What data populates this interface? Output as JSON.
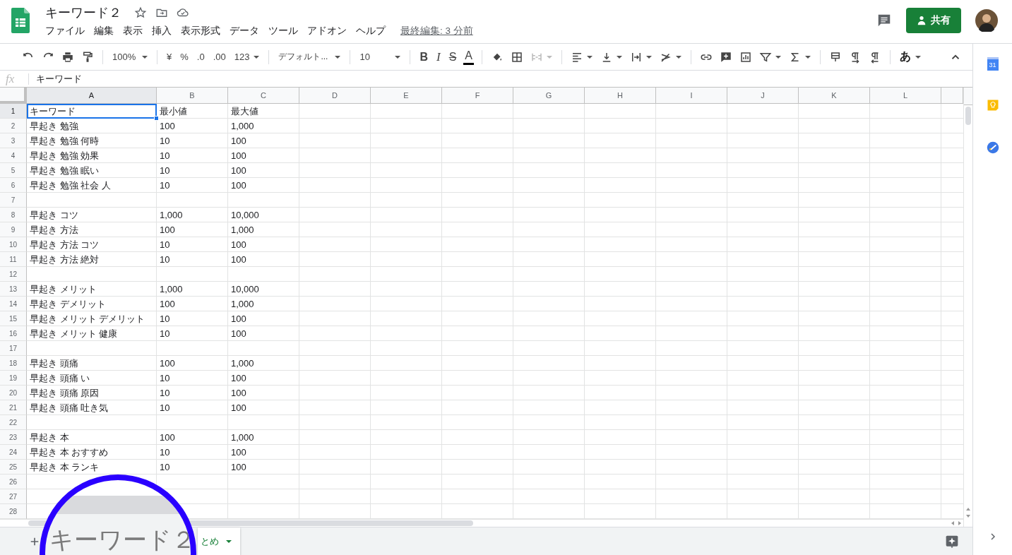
{
  "app": {
    "title": "キーワード２",
    "menus": [
      "ファイル",
      "編集",
      "表示",
      "挿入",
      "表示形式",
      "データ",
      "ツール",
      "アドオン",
      "ヘルプ"
    ],
    "last_edit": "最終編集: 3 分前",
    "share": "共有"
  },
  "toolbar": {
    "zoom": "100%",
    "currency": "¥",
    "percent": "%",
    "decrease_decimal": ".0",
    "increase_decimal": ".00",
    "more_formats": "123",
    "font": "デフォルト...",
    "font_size": "10",
    "bold": "B",
    "italic": "I",
    "strikethrough": "S",
    "text_color": "A",
    "input_tool": "あ"
  },
  "formula_bar": {
    "fx": "fx",
    "value": "キーワード"
  },
  "columns": [
    {
      "label": "A",
      "selected": true
    },
    {
      "label": "B",
      "selected": false
    },
    {
      "label": "C",
      "selected": false
    },
    {
      "label": "D",
      "selected": false
    },
    {
      "label": "E",
      "selected": false
    },
    {
      "label": "F",
      "selected": false
    },
    {
      "label": "G",
      "selected": false
    },
    {
      "label": "H",
      "selected": false
    },
    {
      "label": "I",
      "selected": false
    },
    {
      "label": "J",
      "selected": false
    },
    {
      "label": "K",
      "selected": false
    },
    {
      "label": "L",
      "selected": false
    }
  ],
  "rows": [
    {
      "number": "1",
      "selected": true,
      "cells": [
        "キーワード",
        "最小値",
        "最大値"
      ]
    },
    {
      "number": "2",
      "selected": false,
      "cells": [
        "早起き 勉強",
        "100",
        "1,000"
      ]
    },
    {
      "number": "3",
      "selected": false,
      "cells": [
        "早起き 勉強 何時",
        "10",
        "100"
      ]
    },
    {
      "number": "4",
      "selected": false,
      "cells": [
        "早起き 勉強 効果",
        "10",
        "100"
      ]
    },
    {
      "number": "5",
      "selected": false,
      "cells": [
        "早起き 勉強 眠い",
        "10",
        "100"
      ]
    },
    {
      "number": "6",
      "selected": false,
      "cells": [
        "早起き 勉強 社会 人",
        "10",
        "100"
      ]
    },
    {
      "number": "7",
      "selected": false
    },
    {
      "number": "8",
      "selected": false,
      "cells": [
        "早起き コツ",
        "1,000",
        "10,000"
      ]
    },
    {
      "number": "9",
      "selected": false,
      "cells": [
        "早起き 方法",
        "100",
        "1,000"
      ]
    },
    {
      "number": "10",
      "selected": false,
      "cells": [
        "早起き 方法 コツ",
        "10",
        "100"
      ]
    },
    {
      "number": "11",
      "selected": false,
      "cells": [
        "早起き 方法 絶対",
        "10",
        "100"
      ]
    },
    {
      "number": "12",
      "selected": false
    },
    {
      "number": "13",
      "selected": false,
      "cells": [
        "早起き メリット",
        "1,000",
        "10,000"
      ]
    },
    {
      "number": "14",
      "selected": false,
      "cells": [
        "早起き デメリット",
        "100",
        "1,000"
      ]
    },
    {
      "number": "15",
      "selected": false,
      "cells": [
        "早起き メリット デメリット",
        "10",
        "100"
      ]
    },
    {
      "number": "16",
      "selected": false,
      "cells": [
        "早起き メリット 健康",
        "10",
        "100"
      ]
    },
    {
      "number": "17",
      "selected": false
    },
    {
      "number": "18",
      "selected": false,
      "cells": [
        "早起き 頭痛",
        "100",
        "1,000"
      ]
    },
    {
      "number": "19",
      "selected": false,
      "cells": [
        "早起き 頭痛 い",
        "10",
        "100"
      ]
    },
    {
      "number": "20",
      "selected": false,
      "cells": [
        "早起き 頭痛 原因",
        "10",
        "100"
      ]
    },
    {
      "number": "21",
      "selected": false,
      "cells": [
        "早起き 頭痛 吐き気",
        "10",
        "100"
      ]
    },
    {
      "number": "22",
      "selected": false
    },
    {
      "number": "23",
      "selected": false,
      "cells": [
        "早起き 本",
        "100",
        "1,000"
      ]
    },
    {
      "number": "24",
      "selected": false,
      "cells": [
        "早起き 本 おすすめ",
        "10",
        "100"
      ]
    },
    {
      "number": "25",
      "selected": false,
      "cells": [
        "早起き 本 ランキ",
        "10",
        "100"
      ]
    },
    {
      "number": "26",
      "selected": false
    },
    {
      "number": "27",
      "selected": false
    },
    {
      "number": "28",
      "selected": false
    }
  ],
  "sheet_tabs": [
    {
      "label": "とめ",
      "selected": true
    }
  ],
  "side_panel": {
    "calendar_date": "31"
  },
  "magnifier": {
    "text": "キーワード２"
  }
}
